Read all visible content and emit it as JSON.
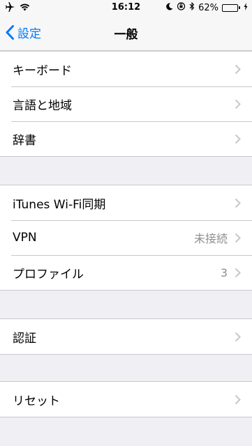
{
  "status_bar": {
    "time": "16:12",
    "battery_percent": "62%",
    "battery_level": 0.62,
    "icons": [
      "airplane-icon",
      "wifi-icon",
      "moon-icon",
      "orientation-lock-icon",
      "bluetooth-icon",
      "charging-icon"
    ]
  },
  "nav": {
    "back_label": "設定",
    "title": "一般"
  },
  "groups": [
    {
      "rows": [
        {
          "label": "キーボード",
          "detail": ""
        },
        {
          "label": "言語と地域",
          "detail": ""
        },
        {
          "label": "辞書",
          "detail": ""
        }
      ]
    },
    {
      "rows": [
        {
          "label": "iTunes Wi-Fi同期",
          "detail": ""
        },
        {
          "label": "VPN",
          "detail": "未接続"
        },
        {
          "label": "プロファイル",
          "detail": "3"
        }
      ]
    },
    {
      "rows": [
        {
          "label": "認証",
          "detail": ""
        }
      ]
    },
    {
      "rows": [
        {
          "label": "リセット",
          "detail": ""
        }
      ]
    }
  ],
  "colors": {
    "accent": "#007aff",
    "background": "#efeff4",
    "battery_fill": "#4cd964",
    "detail_text": "#8e8e93"
  }
}
